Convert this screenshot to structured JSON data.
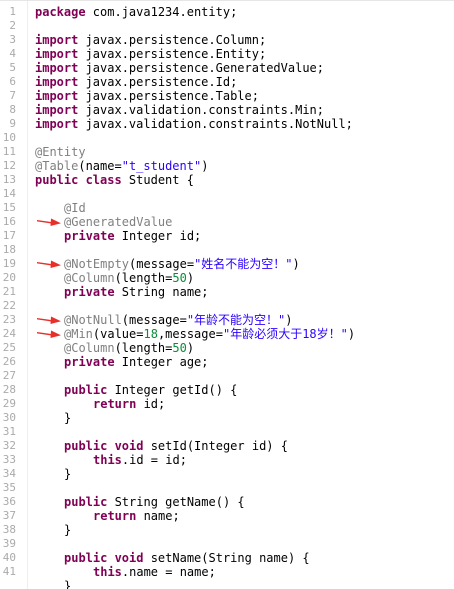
{
  "editor": {
    "colors": {
      "keyword": "#7f0055",
      "annotation": "#808080",
      "string": "#2a00ff",
      "number": "#0a8c3a",
      "arrow": "#e8302a",
      "line_number": "#aaaaaa"
    },
    "lines": [
      {
        "n": "1",
        "indent": 0,
        "tokens": [
          {
            "t": "kw",
            "v": "package"
          },
          {
            "t": "",
            "v": " com.java1234.entity;"
          }
        ]
      },
      {
        "n": "2",
        "indent": 0,
        "tokens": []
      },
      {
        "n": "3",
        "indent": 0,
        "tokens": [
          {
            "t": "kw",
            "v": "import"
          },
          {
            "t": "",
            "v": " javax.persistence.Column;"
          }
        ]
      },
      {
        "n": "4",
        "indent": 0,
        "tokens": [
          {
            "t": "kw",
            "v": "import"
          },
          {
            "t": "",
            "v": " javax.persistence.Entity;"
          }
        ]
      },
      {
        "n": "5",
        "indent": 0,
        "tokens": [
          {
            "t": "kw",
            "v": "import"
          },
          {
            "t": "",
            "v": " javax.persistence.GeneratedValue;"
          }
        ]
      },
      {
        "n": "6",
        "indent": 0,
        "tokens": [
          {
            "t": "kw",
            "v": "import"
          },
          {
            "t": "",
            "v": " javax.persistence.Id;"
          }
        ]
      },
      {
        "n": "7",
        "indent": 0,
        "tokens": [
          {
            "t": "kw",
            "v": "import"
          },
          {
            "t": "",
            "v": " javax.persistence.Table;"
          }
        ]
      },
      {
        "n": "8",
        "indent": 0,
        "tokens": [
          {
            "t": "kw",
            "v": "import"
          },
          {
            "t": "",
            "v": " javax.validation.constraints.Min;"
          }
        ]
      },
      {
        "n": "9",
        "indent": 0,
        "tokens": [
          {
            "t": "kw",
            "v": "import"
          },
          {
            "t": "",
            "v": " javax.validation.constraints.NotNull;"
          }
        ]
      },
      {
        "n": "10",
        "indent": 0,
        "tokens": []
      },
      {
        "n": "11",
        "indent": 0,
        "tokens": [
          {
            "t": "an",
            "v": "@Entity"
          }
        ]
      },
      {
        "n": "12",
        "indent": 0,
        "tokens": [
          {
            "t": "an",
            "v": "@Table"
          },
          {
            "t": "",
            "v": "(name="
          },
          {
            "t": "str",
            "v": "\"t_student\""
          },
          {
            "t": "",
            "v": ")"
          }
        ]
      },
      {
        "n": "13",
        "indent": 0,
        "tokens": [
          {
            "t": "kw",
            "v": "public class"
          },
          {
            "t": "",
            "v": " Student {"
          }
        ]
      },
      {
        "n": "14",
        "indent": 0,
        "tokens": []
      },
      {
        "n": "15",
        "indent": 1,
        "tokens": [
          {
            "t": "an",
            "v": "@Id"
          }
        ]
      },
      {
        "n": "16",
        "indent": 1,
        "tokens": [
          {
            "t": "an",
            "v": "@GeneratedValue"
          }
        ],
        "arrow": true
      },
      {
        "n": "17",
        "indent": 1,
        "tokens": [
          {
            "t": "kw",
            "v": "private"
          },
          {
            "t": "",
            "v": " Integer id;"
          }
        ]
      },
      {
        "n": "18",
        "indent": 0,
        "tokens": []
      },
      {
        "n": "19",
        "indent": 1,
        "tokens": [
          {
            "t": "an",
            "v": "@NotEmpty"
          },
          {
            "t": "",
            "v": "(message="
          },
          {
            "t": "str",
            "v": "\"姓名不能为空！\""
          },
          {
            "t": "",
            "v": ")"
          }
        ],
        "arrow": true
      },
      {
        "n": "20",
        "indent": 1,
        "tokens": [
          {
            "t": "an",
            "v": "@Column"
          },
          {
            "t": "",
            "v": "(length="
          },
          {
            "t": "num",
            "v": "50"
          },
          {
            "t": "",
            "v": ")"
          }
        ]
      },
      {
        "n": "21",
        "indent": 1,
        "tokens": [
          {
            "t": "kw",
            "v": "private"
          },
          {
            "t": "",
            "v": " String name;"
          }
        ]
      },
      {
        "n": "22",
        "indent": 0,
        "tokens": []
      },
      {
        "n": "23",
        "indent": 1,
        "tokens": [
          {
            "t": "an",
            "v": "@NotNull"
          },
          {
            "t": "",
            "v": "(message="
          },
          {
            "t": "str",
            "v": "\"年龄不能为空！\""
          },
          {
            "t": "",
            "v": ")"
          }
        ],
        "arrow": true
      },
      {
        "n": "24",
        "indent": 1,
        "tokens": [
          {
            "t": "an",
            "v": "@Min"
          },
          {
            "t": "",
            "v": "(value="
          },
          {
            "t": "num",
            "v": "18"
          },
          {
            "t": "",
            "v": ",message="
          },
          {
            "t": "str",
            "v": "\"年龄必须大于18岁！\""
          },
          {
            "t": "",
            "v": ")"
          }
        ],
        "arrow": true
      },
      {
        "n": "25",
        "indent": 1,
        "tokens": [
          {
            "t": "an",
            "v": "@Column"
          },
          {
            "t": "",
            "v": "(length="
          },
          {
            "t": "num",
            "v": "50"
          },
          {
            "t": "",
            "v": ")"
          }
        ]
      },
      {
        "n": "26",
        "indent": 1,
        "tokens": [
          {
            "t": "kw",
            "v": "private"
          },
          {
            "t": "",
            "v": " Integer age;"
          }
        ]
      },
      {
        "n": "27",
        "indent": 0,
        "tokens": []
      },
      {
        "n": "28",
        "indent": 1,
        "tokens": [
          {
            "t": "kw",
            "v": "public"
          },
          {
            "t": "",
            "v": " Integer getId() {"
          }
        ]
      },
      {
        "n": "29",
        "indent": 2,
        "tokens": [
          {
            "t": "kw",
            "v": "return"
          },
          {
            "t": "",
            "v": " id;"
          }
        ]
      },
      {
        "n": "30",
        "indent": 1,
        "tokens": [
          {
            "t": "",
            "v": "}"
          }
        ]
      },
      {
        "n": "31",
        "indent": 0,
        "tokens": []
      },
      {
        "n": "32",
        "indent": 1,
        "tokens": [
          {
            "t": "kw",
            "v": "public void"
          },
          {
            "t": "",
            "v": " setId(Integer id) {"
          }
        ]
      },
      {
        "n": "33",
        "indent": 2,
        "tokens": [
          {
            "t": "kw",
            "v": "this"
          },
          {
            "t": "",
            "v": ".id = id;"
          }
        ]
      },
      {
        "n": "34",
        "indent": 1,
        "tokens": [
          {
            "t": "",
            "v": "}"
          }
        ]
      },
      {
        "n": "35",
        "indent": 0,
        "tokens": []
      },
      {
        "n": "36",
        "indent": 1,
        "tokens": [
          {
            "t": "kw",
            "v": "public"
          },
          {
            "t": "",
            "v": " String getName() {"
          }
        ]
      },
      {
        "n": "37",
        "indent": 2,
        "tokens": [
          {
            "t": "kw",
            "v": "return"
          },
          {
            "t": "",
            "v": " name;"
          }
        ]
      },
      {
        "n": "38",
        "indent": 1,
        "tokens": [
          {
            "t": "",
            "v": "}"
          }
        ]
      },
      {
        "n": "39",
        "indent": 0,
        "tokens": []
      },
      {
        "n": "40",
        "indent": 1,
        "tokens": [
          {
            "t": "kw",
            "v": "public void"
          },
          {
            "t": "",
            "v": " setName(String name) {"
          }
        ]
      },
      {
        "n": "41",
        "indent": 2,
        "tokens": [
          {
            "t": "kw",
            "v": "this"
          },
          {
            "t": "",
            "v": ".name = name;"
          }
        ]
      },
      {
        "n": "",
        "indent": 1,
        "tokens": [
          {
            "t": "",
            "v": "}"
          }
        ]
      }
    ]
  }
}
